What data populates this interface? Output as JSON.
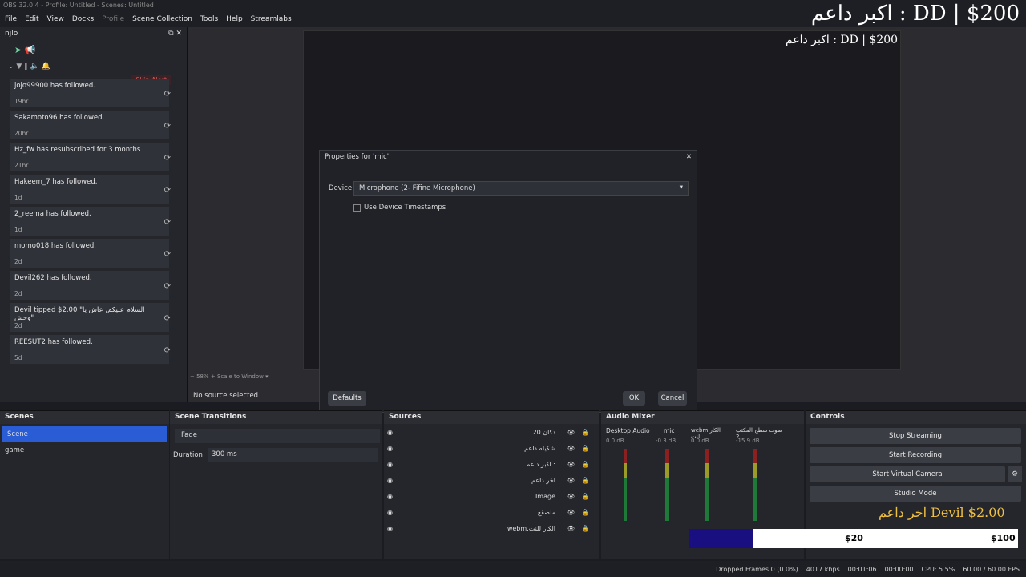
{
  "window_title": "OBS 32.0.4 - Profile: Untitled - Scenes: Untitled",
  "menu": [
    "File",
    "Edit",
    "View",
    "Docks",
    "Profile",
    "Scene Collection",
    "Tools",
    "Help",
    "Streamlabs"
  ],
  "overlay_top": "اكبر داعم : DD | $200",
  "nested_overlay": "اكبر داعم : DD | $200",
  "dock": {
    "title": "njlo",
    "skip_label": "Skip Alert",
    "items": [
      {
        "msg": "jojo99900 has followed.",
        "time": "19hr"
      },
      {
        "msg": "Sakamoto96 has followed.",
        "time": "20hr"
      },
      {
        "msg": "Hz_fw has resubscribed for 3 months",
        "time": "21hr"
      },
      {
        "msg": "Hakeem_7 has followed.",
        "time": "1d"
      },
      {
        "msg": "2_reema has followed.",
        "time": "1d"
      },
      {
        "msg": "momo018 has followed.",
        "time": "2d"
      },
      {
        "msg": "Devil262 has followed.",
        "time": "2d"
      },
      {
        "msg": "Devil tipped $2.00 \"السلام عليكم, عاش يا وحش\"",
        "time": "2d"
      },
      {
        "msg": "REESUT2 has followed.",
        "time": "5d"
      }
    ]
  },
  "dialog": {
    "title": "Properties for 'mic'",
    "device_label": "Device",
    "device_value": "Microphone (2- Fifine Microphone)",
    "timestamps_label": "Use Device Timestamps",
    "defaults": "Defaults",
    "ok": "OK",
    "cancel": "Cancel"
  },
  "no_source": "No source selected",
  "scenes": {
    "title": "Scenes",
    "items": [
      "Scene",
      "game"
    ]
  },
  "transitions": {
    "title": "Scene Transitions",
    "value": "Fade",
    "duration_label": "Duration",
    "duration": "300 ms"
  },
  "sources": {
    "title": "Sources",
    "items": [
      "دكان 20",
      "شكيله داعم",
      "اكبر داعم :",
      "اخر داعم",
      "Image",
      "ملصقع",
      "webm.الكار للنت"
    ]
  },
  "mixer": {
    "title": "Audio Mixer",
    "channels": [
      {
        "name": "Desktop Audio",
        "db": "0.0 dB"
      },
      {
        "name": "mic",
        "db": "-0.3 dB"
      },
      {
        "name": "webm.الكار للنت",
        "db": "0.0 dB"
      },
      {
        "name": "صوت سطح المكتب 2",
        "db": "-15.9 dB"
      }
    ]
  },
  "controls": {
    "title": "Controls",
    "buttons": [
      "Stop Streaming",
      "Start Recording",
      "Start Virtual Camera",
      "Studio Mode"
    ]
  },
  "donation": {
    "text": "اخر داعم Devil $2.00",
    "goal_left": "$20",
    "goal_right": "$100"
  },
  "status": {
    "dropped": "Dropped Frames 0 (0.0%)",
    "kbps": "4017 kbps",
    "stream_time": "00:01:06",
    "rec_time": "00:00:00",
    "cpu": "CPU: 5.5%",
    "fps": "60.00 / 60.00 FPS"
  }
}
